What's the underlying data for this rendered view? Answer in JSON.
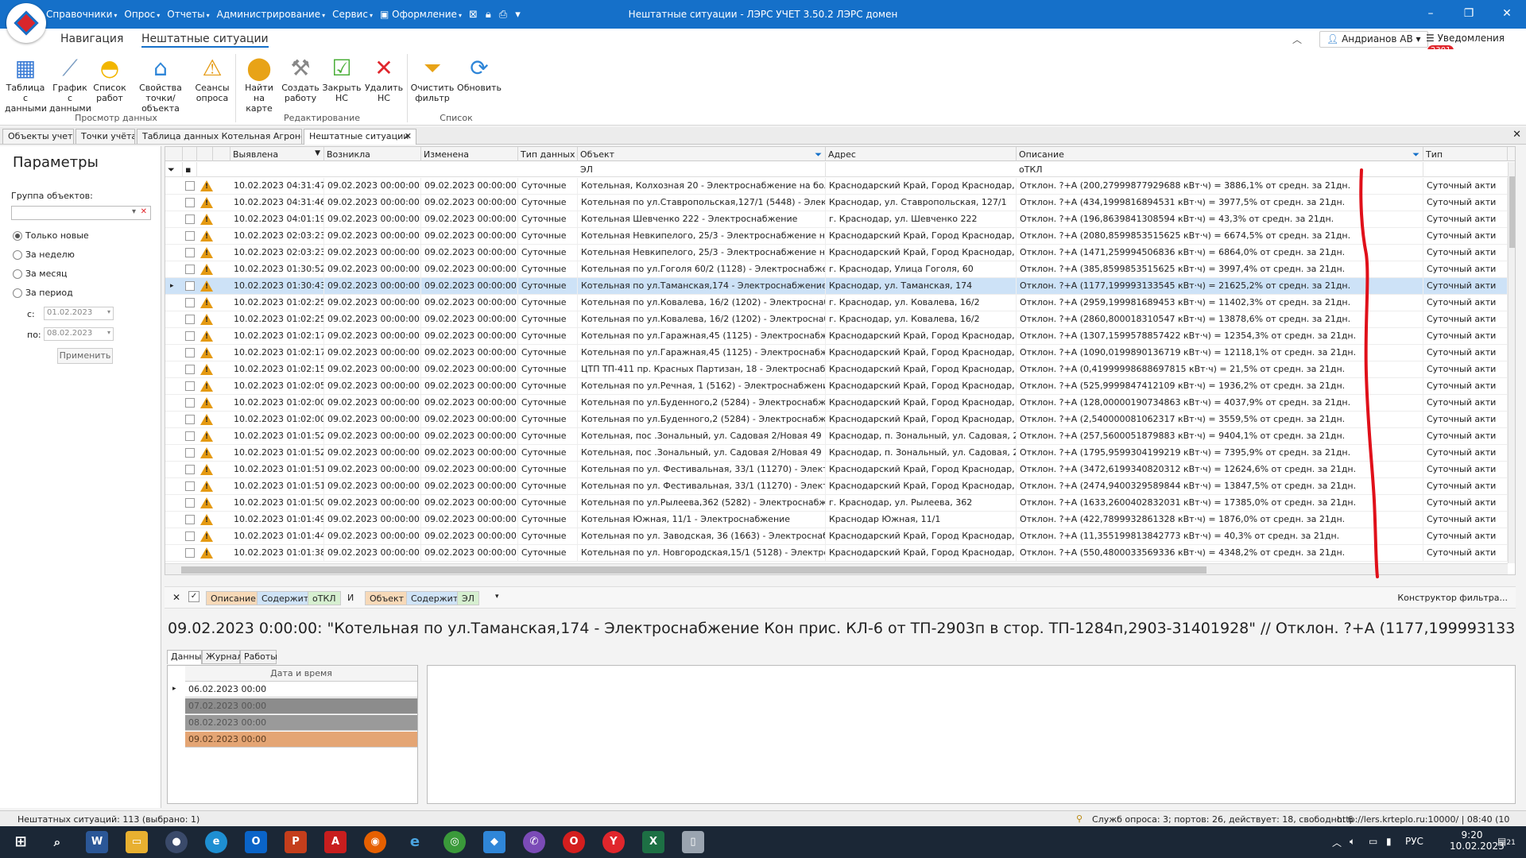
{
  "window": {
    "title": "Нештатные ситуации - ЛЭРС УЧЕТ 3.50.2 ЛЭРС домен",
    "menus": [
      "Справочники",
      "Опрос",
      "Отчеты",
      "Администрирование",
      "Сервис",
      "Оформление"
    ]
  },
  "ribbon_tabs": [
    "Навигация",
    "Нештатные ситуации"
  ],
  "user": {
    "name": "Андрианов АВ",
    "notifications_label": "Уведомления",
    "notifications_count": "2301"
  },
  "ribbon": {
    "buttons": [
      {
        "l1": "Таблица с",
        "l2": "данными"
      },
      {
        "l1": "График с",
        "l2": "данными"
      },
      {
        "l1": "Список",
        "l2": "работ"
      },
      {
        "l1": "Свойства",
        "l2": "точки/объекта"
      },
      {
        "l1": "Сеансы",
        "l2": "опроса"
      },
      {
        "l1": "Найти на",
        "l2": "карте"
      },
      {
        "l1": "Создать",
        "l2": "работу"
      },
      {
        "l1": "Закрыть",
        "l2": "НС"
      },
      {
        "l1": "Удалить",
        "l2": "НС"
      },
      {
        "l1": "Очистить",
        "l2": "фильтр"
      },
      {
        "l1": "Обновить",
        "l2": ""
      }
    ],
    "groups": [
      "Просмотр данных",
      "Редактирование",
      "Список"
    ]
  },
  "doc_tabs": [
    "Объекты учета",
    "Точки учёта",
    "Таблица данных Котельная Агрономич",
    "Нештатные ситуации"
  ],
  "params": {
    "title": "Параметры",
    "group_label": "Группа объектов:",
    "radios": [
      "Только новые",
      "За неделю",
      "За месяц",
      "За период"
    ],
    "from_label": "с:",
    "from_value": "01.02.2023",
    "to_label": "по:",
    "to_value": "08.02.2023",
    "apply": "Применить"
  },
  "grid": {
    "columns": [
      "Выявлена",
      "Возникла",
      "Изменена",
      "Тип данных",
      "Объект",
      "Адрес",
      "Описание",
      "Тип"
    ],
    "filter_object": "ЭЛ",
    "filter_desc": "оТКЛ",
    "type_value": "Суточный акти",
    "rows": [
      [
        "10.02.2023 04:31:47",
        "09.02.2023 00:00:00",
        "09.02.2023 00:00:00",
        "Суточные",
        "Котельная, Колхозная 20 - Электроснабжение на болт.п...",
        "Краснодарский Край, Город Краснодар, У...",
        "Отклон. ?+A (200,27999877929688 кВт·ч) = 3886,1% от средн. за 21дн."
      ],
      [
        "10.02.2023 04:31:46",
        "09.02.2023 00:00:00",
        "09.02.2023 00:00:00",
        "Суточные",
        "Котельная по ул.Ставропольская,127/1 (5448) - Электро...",
        "Краснодар, ул. Ставропольская, 127/1",
        "Отклон. ?+A (434,1999816894531 кВт·ч) = 3977,5% от средн. за 21дн."
      ],
      [
        "10.02.2023 04:01:19",
        "09.02.2023 00:00:00",
        "09.02.2023 00:00:00",
        "Суточные",
        "Котельная Шевченко 222 - Электроснабжение",
        "г. Краснодар, ул. Шевченко 222",
        "Отклон. ?+A (196,8639841308594 кВт·ч) = 43,3% от средн. за 21дн."
      ],
      [
        "10.02.2023 02:03:23",
        "09.02.2023 00:00:00",
        "09.02.2023 00:00:00",
        "Суточные",
        "Котельная Невкипелого, 25/3 - Электроснабжение на бо...",
        "Краснодарский Край, Город Краснодар, У...",
        "Отклон. ?+A (2080,8599853515625 кВт·ч) = 6674,5% от средн. за 21дн."
      ],
      [
        "10.02.2023 02:03:23",
        "09.02.2023 00:00:00",
        "09.02.2023 00:00:00",
        "Суточные",
        "Котельная Невкипелого, 25/3 - Электроснабжение на бо...",
        "Краснодарский Край, Город Краснодар, У...",
        "Отклон. ?+A (1471,259994506836 кВт·ч) = 6864,0% от средн. за 21дн."
      ],
      [
        "10.02.2023 01:30:52",
        "09.02.2023 00:00:00",
        "09.02.2023 00:00:00",
        "Суточные",
        "Котельная по ул.Гоголя 60/2 (1128) - Электроснабжение",
        "г. Краснодар, Улица Гоголя, 60",
        "Отклон. ?+A (385,8599853515625 кВт·ч) = 3997,4% от средн. за 21дн."
      ],
      [
        "10.02.2023 01:30:43",
        "09.02.2023 00:00:00",
        "09.02.2023 00:00:00",
        "Суточные",
        "Котельная по ул.Таманская,174 - Электроснабжение Кон...",
        "Краснодар, ул. Таманская, 174",
        "Отклон. ?+A (1177,199993133545 кВт·ч) = 21625,2% от средн. за 21дн."
      ],
      [
        "10.02.2023 01:02:25",
        "09.02.2023 00:00:00",
        "09.02.2023 00:00:00",
        "Суточные",
        "Котельная по ул.Ковалева, 16/2 (1202) - Электроснабжен...",
        "г. Краснодар, ул. Ковалева, 16/2",
        "Отклон. ?+A (2959,199981689453 кВт·ч) = 11402,3% от средн. за 21дн."
      ],
      [
        "10.02.2023 01:02:25",
        "09.02.2023 00:00:00",
        "09.02.2023 00:00:00",
        "Суточные",
        "Котельная по ул.Ковалева, 16/2 (1202) - Электроснабжен...",
        "г. Краснодар, ул. Ковалева, 16/2",
        "Отклон. ?+A (2860,800018310547 кВт·ч) = 13878,6% от средн. за 21дн."
      ],
      [
        "10.02.2023 01:02:17",
        "09.02.2023 00:00:00",
        "09.02.2023 00:00:00",
        "Суточные",
        "Котельная по ул.Гаражная,45 (1125) - Электроснабжени...",
        "Краснодарский Край, Город Краснодар, У...",
        "Отклон. ?+A (1307,1599578857422 кВт·ч) = 12354,3% от средн. за 21дн."
      ],
      [
        "10.02.2023 01:02:17",
        "09.02.2023 00:00:00",
        "09.02.2023 00:00:00",
        "Суточные",
        "Котельная по ул.Гаражная,45 (1125) - Электроснабжени...",
        "Краснодарский Край, Город Краснодар, У...",
        "Отклон. ?+A (1090,0199890136719 кВт·ч) = 12118,1% от средн. за 21дн."
      ],
      [
        "10.02.2023 01:02:15",
        "09.02.2023 00:00:00",
        "09.02.2023 00:00:00",
        "Суточные",
        "ЦТП ТП-411 пр. Красных Партизан, 18 - Электроснабже...",
        "Краснодарский Край, Город Краснодар, П...",
        "Отклон. ?+A (0,41999998688697815 кВт·ч) = 21,5% от средн. за 21дн."
      ],
      [
        "10.02.2023 01:02:05",
        "09.02.2023 00:00:00",
        "09.02.2023 00:00:00",
        "Суточные",
        "Котельная по ул.Речная, 1 (5162) - Электроснабжение в н...",
        "Краснодарский Край, Город Краснодар, У...",
        "Отклон. ?+A (525,9999847412109 кВт·ч) = 1936,2% от средн. за 21дн."
      ],
      [
        "10.02.2023 01:02:00",
        "09.02.2023 00:00:00",
        "09.02.2023 00:00:00",
        "Суточные",
        "Котельная по ул.Буденного,2 (5284) - Электроснабжение...",
        "Краснодарский Край, Город Краснодар, У...",
        "Отклон. ?+A (128,00000190734863 кВт·ч) = 4037,9% от средн. за 21дн."
      ],
      [
        "10.02.2023 01:02:00",
        "09.02.2023 00:00:00",
        "09.02.2023 00:00:00",
        "Суточные",
        "Котельная по ул.Буденного,2 (5284) - Электроснабжение...",
        "Краснодарский Край, Город Краснодар, У...",
        "Отклон. ?+A (2,540000081062317 кВт·ч) = 3559,5% от средн. за 21дн."
      ],
      [
        "10.02.2023 01:01:52",
        "09.02.2023 00:00:00",
        "09.02.2023 00:00:00",
        "Суточные",
        "Котельная, пос .Зональный, ул. Садовая 2/Новая 49 (480...",
        "Краснодар, п. Зональный, ул. Садовая, 2/...",
        "Отклон. ?+A (257,5600051879883 кВт·ч) = 9404,1% от средн. за 21дн."
      ],
      [
        "10.02.2023 01:01:52",
        "09.02.2023 00:00:00",
        "09.02.2023 00:00:00",
        "Суточные",
        "Котельная, пос .Зональный, ул. Садовая 2/Новая 49 (480...",
        "Краснодар, п. Зональный, ул. Садовая, 2/...",
        "Отклон. ?+A (1795,9599304199219 кВт·ч) = 7395,9% от средн. за 21дн."
      ],
      [
        "10.02.2023 01:01:51",
        "09.02.2023 00:00:00",
        "09.02.2023 00:00:00",
        "Суточные",
        "Котельная по ул. Фестивальная, 33/1 (11270) - Электрос...",
        "Краснодарский Край, Город Краснодар, У...",
        "Отклон. ?+A (3472,6199340820312 кВт·ч) = 12624,6% от средн. за 21дн."
      ],
      [
        "10.02.2023 01:01:51",
        "09.02.2023 00:00:00",
        "09.02.2023 00:00:00",
        "Суточные",
        "Котельная по ул. Фестивальная, 33/1 (11270) - Электрос...",
        "Краснодарский Край, Город Краснодар, У...",
        "Отклон. ?+A (2474,9400329589844 кВт·ч) = 13847,5% от средн. за 21дн."
      ],
      [
        "10.02.2023 01:01:50",
        "09.02.2023 00:00:00",
        "09.02.2023 00:00:00",
        "Суточные",
        "Котельная по ул.Рылеева,362 (5282) - Электроснабжени...",
        "г. Краснодар, ул. Рылеева, 362",
        "Отклон. ?+A (1633,2600402832031 кВт·ч) = 17385,0% от средн. за 21дн."
      ],
      [
        "10.02.2023 01:01:49",
        "09.02.2023 00:00:00",
        "09.02.2023 00:00:00",
        "Суточные",
        "Котельная Южная, 11/1 - Электроснабжение",
        "Краснодар Южная, 11/1",
        "Отклон. ?+A (422,7899932861328 кВт·ч) = 1876,0% от средн. за 21дн."
      ],
      [
        "10.02.2023 01:01:44",
        "09.02.2023 00:00:00",
        "09.02.2023 00:00:00",
        "Суточные",
        "Котельная по ул. Заводская, 36 (1663) - Электроснабжение",
        "Краснодарский Край, Город Краснодар, У...",
        "Отклон. ?+A (11,355199813842773 кВт·ч) = 40,3% от средн. за 21дн."
      ],
      [
        "10.02.2023 01:01:38",
        "09.02.2023 00:00:00",
        "09.02.2023 00:00:00",
        "Суточные",
        "Котельная по ул. Новгородская,15/1 (5128) - Электросна...",
        "Краснодарский Край, Город Краснодар, У...",
        "Отклон. ?+A (550,4800033569336 кВт·ч) = 4348,2% от средн. за 21дн."
      ]
    ]
  },
  "filter": {
    "close": "✕",
    "check": "✓",
    "t1": "Описание",
    "op1": "Содержит",
    "v1": "оТКЛ",
    "and": "И",
    "t2": "Объект",
    "op2": "Содержит",
    "v2": "ЭЛ",
    "builder": "Конструктор фильтра..."
  },
  "detail_text": "09.02.2023 0:00:00: \"Котельная по ул.Таманская,174 - Электроснабжение Кон прис. КЛ-6 от ТП-2903п в стор. ТП-1284п,2903-31401928\" // Отклон. ?+A (1177,199993133545 кВт·ч) = 21625,2...",
  "bottom_tabs": [
    "Данные",
    "Журнал",
    "Работы"
  ],
  "dates": {
    "header": "Дата и время",
    "rows": [
      "06.02.2023 00:00",
      "07.02.2023 00:00",
      "08.02.2023 00:00",
      "09.02.2023 00:00"
    ]
  },
  "status": {
    "left": "Нештатных ситуаций: 113 (выбрано: 1)",
    "services": "Служб опроса: 3; портов: 26, действует: 18, свободно: 6",
    "url": "http://lers.krteplo.ru:10000/ | 08:40 (10 фев)"
  },
  "taskbar": {
    "lang": "РУС",
    "time": "9:20",
    "date": "10.02.2023",
    "notif_count": "21"
  },
  "colors": {
    "titlebar": "#1570c9",
    "selected_row": "#cde2f7",
    "warning": "#e59a12",
    "annotation_red": "#e0101a",
    "date_highlight": "#e4a574"
  }
}
